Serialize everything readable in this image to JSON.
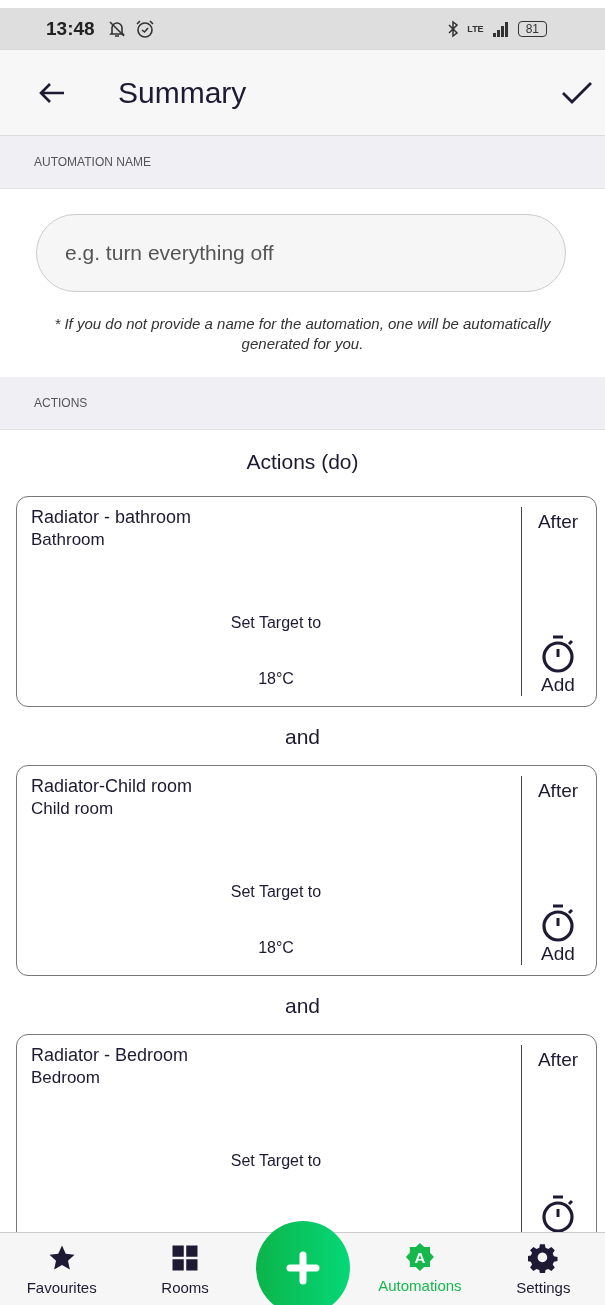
{
  "status_bar": {
    "time": "13:48",
    "network": "LTE",
    "battery": "81"
  },
  "app_bar": {
    "title": "Summary"
  },
  "name_section": {
    "header": "AUTOMATION NAME",
    "placeholder": "e.g. turn everything off",
    "note": "* If you do not provide a name for the automation, one will be automatically generated for you."
  },
  "actions_section": {
    "header": "ACTIONS",
    "title": "Actions (do)",
    "actions": [
      {
        "device": "Radiator - bathroom",
        "room": "Bathroom",
        "action": "Set Target to",
        "value": "18°C",
        "after_label": "After",
        "add_label": "Add"
      },
      {
        "separator": "and",
        "device": "Radiator-Child room",
        "room": "Child room",
        "action": "Set Target to",
        "value": "18°C",
        "after_label": "After",
        "add_label": "Add"
      },
      {
        "separator": "and",
        "device": "Radiator - Bedroom",
        "room": "Bedroom",
        "action": "Set Target to",
        "after_label": "After"
      }
    ]
  },
  "bottom_nav": [
    {
      "kind": "favourites",
      "label": "Favourites",
      "selected": false
    },
    {
      "kind": "rooms",
      "label": "Rooms",
      "selected": false
    },
    {
      "kind": "add"
    },
    {
      "kind": "automations",
      "label": "Automations",
      "icon_letter": "A",
      "selected": true
    },
    {
      "kind": "settings",
      "label": "Settings",
      "selected": false
    }
  ]
}
